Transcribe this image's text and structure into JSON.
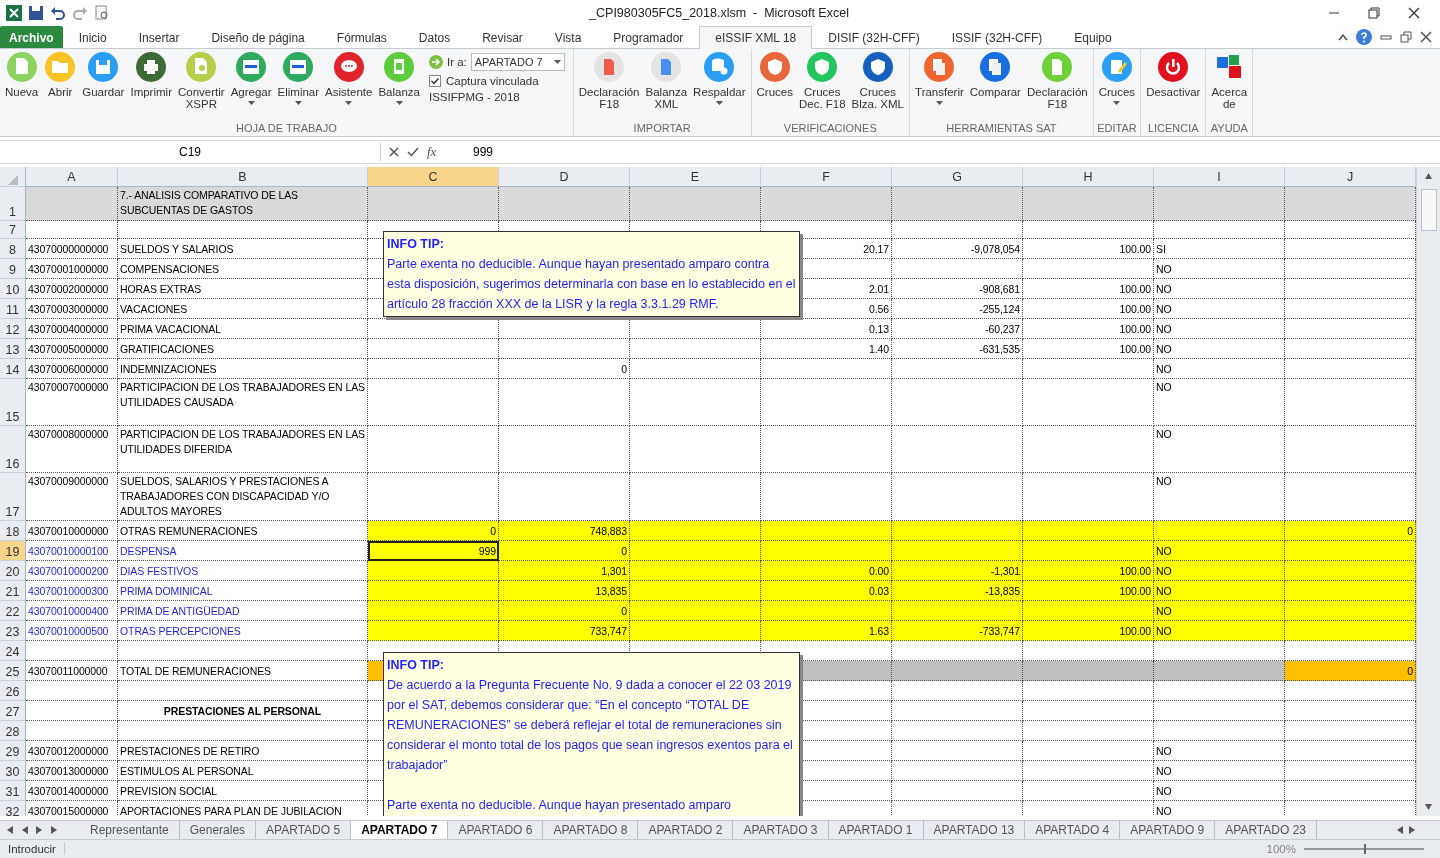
{
  "window": {
    "title": "_CPI980305FC5_2018.xlsm  -  Microsoft Excel"
  },
  "tabs": [
    {
      "label": "Archivo",
      "kind": "file",
      "selected": false
    },
    {
      "label": "Inicio",
      "kind": "tab",
      "selected": false
    },
    {
      "label": "Insertar",
      "kind": "tab",
      "selected": false
    },
    {
      "label": "Diseño de página",
      "kind": "tab",
      "selected": false
    },
    {
      "label": "Fórmulas",
      "kind": "tab",
      "selected": false
    },
    {
      "label": "Datos",
      "kind": "tab",
      "selected": false
    },
    {
      "label": "Revisar",
      "kind": "tab",
      "selected": false
    },
    {
      "label": "Vista",
      "kind": "tab",
      "selected": false
    },
    {
      "label": "Programador",
      "kind": "tab",
      "selected": false
    },
    {
      "label": "eISSIF XML 18",
      "kind": "tab",
      "selected": true
    },
    {
      "label": "DISIF (32H-CFF)",
      "kind": "tab",
      "selected": false
    },
    {
      "label": "ISSIF (32H-CFF)",
      "kind": "tab",
      "selected": false
    },
    {
      "label": "Equipo",
      "kind": "tab",
      "selected": false
    }
  ],
  "ribbon": {
    "groups": [
      {
        "label": "HOJA DE TRABAJO",
        "buttons": [
          {
            "label": "Nueva",
            "dropdown": false
          },
          {
            "label": "Abrir",
            "dropdown": false
          },
          {
            "label": "Guardar",
            "dropdown": false
          },
          {
            "label": "Imprimir",
            "dropdown": false
          },
          {
            "label": "Convertir\nXSPR",
            "dropdown": false
          },
          {
            "label": "Agregar",
            "dropdown": true
          },
          {
            "label": "Eliminar",
            "dropdown": true
          },
          {
            "label": "Asistente",
            "dropdown": true
          },
          {
            "label": "Balanza",
            "dropdown": true
          }
        ],
        "goto": {
          "label": "Ir a:",
          "value": "APARTADO 7"
        },
        "checkbox": {
          "label": "Captura vinculada",
          "checked": true
        },
        "note": "ISSIFPMG - 2018"
      },
      {
        "label": "IMPORTAR",
        "buttons": [
          {
            "label": "Declaración\nF18",
            "dropdown": false
          },
          {
            "label": "Balanza\nXML",
            "dropdown": false
          },
          {
            "label": "Respaldar",
            "dropdown": true
          }
        ]
      },
      {
        "label": "VERIFICACIONES",
        "buttons": [
          {
            "label": "Cruces",
            "dropdown": false
          },
          {
            "label": "Cruces\nDec. F18",
            "dropdown": false
          },
          {
            "label": "Cruces\nBlza. XML",
            "dropdown": false
          }
        ]
      },
      {
        "label": "HERRAMIENTAS SAT",
        "buttons": [
          {
            "label": "Transferir",
            "dropdown": true
          },
          {
            "label": "Comparar",
            "dropdown": false
          },
          {
            "label": "Declaración\nF18",
            "dropdown": false
          }
        ]
      },
      {
        "label": "EDITAR",
        "buttons": [
          {
            "label": "Cruces",
            "dropdown": true
          }
        ]
      },
      {
        "label": "LICENCIA",
        "buttons": [
          {
            "label": "Desactivar",
            "dropdown": false
          }
        ]
      },
      {
        "label": "AYUDA",
        "buttons": [
          {
            "label": "Acerca\nde",
            "dropdown": false
          }
        ]
      }
    ]
  },
  "formula_bar": {
    "name_box": "C19",
    "function_label": "fx",
    "value": "999"
  },
  "columns": [
    {
      "label": "A",
      "selected": false
    },
    {
      "label": "B",
      "selected": false
    },
    {
      "label": "C",
      "selected": true
    },
    {
      "label": "D",
      "selected": false
    },
    {
      "label": "E",
      "selected": false
    },
    {
      "label": "F",
      "selected": false
    },
    {
      "label": "G",
      "selected": false
    },
    {
      "label": "H",
      "selected": false
    },
    {
      "label": "I",
      "selected": false
    },
    {
      "label": "J",
      "selected": false
    }
  ],
  "rows": [
    {
      "n": "1",
      "kind": "header",
      "highlighted": false,
      "link": false,
      "selected": false,
      "cells": [
        "",
        "7.- ANALISIS COMPARATIVO DE LAS\nSUBCUENTAS DE GASTOS",
        "",
        "",
        "",
        "",
        "",
        "",
        "",
        ""
      ]
    },
    {
      "n": "7",
      "kind": "plain",
      "highlighted": false,
      "link": false,
      "selected": false,
      "cells": [
        "",
        "",
        "",
        "",
        "",
        "",
        "",
        "",
        "",
        ""
      ]
    },
    {
      "n": "8",
      "kind": "plain",
      "highlighted": false,
      "link": false,
      "selected": false,
      "cells": [
        "43070000000000",
        "SUELDOS Y SALARIOS",
        "",
        "",
        "",
        "20.17",
        "-9,078,054",
        "100.00",
        "SI",
        ""
      ]
    },
    {
      "n": "9",
      "kind": "plain",
      "highlighted": false,
      "link": false,
      "selected": false,
      "cells": [
        "43070001000000",
        "COMPENSACIONES",
        "",
        "",
        "",
        "",
        "",
        "",
        "NO",
        ""
      ]
    },
    {
      "n": "10",
      "kind": "plain",
      "highlighted": false,
      "link": false,
      "selected": false,
      "cells": [
        "43070002000000",
        "HORAS EXTRAS",
        "",
        "",
        "",
        "2.01",
        "-908,681",
        "100.00",
        "NO",
        ""
      ]
    },
    {
      "n": "11",
      "kind": "plain",
      "highlighted": false,
      "link": false,
      "selected": false,
      "cells": [
        "43070003000000",
        "VACACIONES",
        "",
        "",
        "",
        "0.56",
        "-255,124",
        "100.00",
        "NO",
        ""
      ]
    },
    {
      "n": "12",
      "kind": "plain",
      "highlighted": false,
      "link": false,
      "selected": false,
      "cells": [
        "43070004000000",
        "PRIMA VACACIONAL",
        "",
        "",
        "",
        "0.13",
        "-60,237",
        "100.00",
        "NO",
        ""
      ]
    },
    {
      "n": "13",
      "kind": "plain",
      "highlighted": false,
      "link": false,
      "selected": false,
      "cells": [
        "43070005000000",
        "GRATIFICACIONES",
        "",
        "",
        "",
        "1.40",
        "-631,535",
        "100.00",
        "NO",
        ""
      ]
    },
    {
      "n": "14",
      "kind": "plain",
      "highlighted": false,
      "link": false,
      "selected": false,
      "cells": [
        "43070006000000",
        "INDEMNIZACIONES",
        "",
        "0",
        "",
        "",
        "",
        "",
        "NO",
        ""
      ]
    },
    {
      "n": "15",
      "kind": "tall",
      "highlighted": false,
      "link": false,
      "selected": false,
      "cells": [
        "43070007000000",
        "PARTICIPACION DE LOS TRABAJADORES EN LAS\nUTILIDADES CAUSADA",
        "",
        "",
        "",
        "",
        "",
        "",
        "NO",
        ""
      ]
    },
    {
      "n": "16",
      "kind": "tall",
      "highlighted": false,
      "link": false,
      "selected": false,
      "cells": [
        "43070008000000",
        "PARTICIPACION DE LOS TRABAJADORES EN LAS\nUTILIDADES DIFERIDA",
        "",
        "",
        "",
        "",
        "",
        "",
        "NO",
        ""
      ]
    },
    {
      "n": "17",
      "kind": "tall",
      "highlighted": false,
      "link": false,
      "selected": false,
      "cells": [
        "43070009000000",
        "SUELDOS, SALARIOS Y PRESTACIONES A\nTRABAJADORES CON DISCAPACIDAD Y/O\nADULTOS MAYORES",
        "",
        "",
        "",
        "",
        "",
        "",
        "NO",
        ""
      ]
    },
    {
      "n": "18",
      "kind": "plain",
      "highlighted": true,
      "link": false,
      "selected": false,
      "cells": [
        "43070010000000",
        "OTRAS REMUNERACIONES",
        "0",
        "748,883",
        "",
        "",
        "",
        "",
        "",
        "0"
      ]
    },
    {
      "n": "19",
      "kind": "plain",
      "highlighted": true,
      "link": true,
      "selected": true,
      "cells": [
        "43070010000100",
        "DESPENSA",
        "999",
        "0",
        "",
        "",
        "",
        "",
        "NO",
        ""
      ]
    },
    {
      "n": "20",
      "kind": "plain",
      "highlighted": true,
      "link": true,
      "selected": false,
      "cells": [
        "43070010000200",
        "DIAS FESTIVOS",
        "",
        "1,301",
        "",
        "0.00",
        "-1,301",
        "100.00",
        "NO",
        ""
      ]
    },
    {
      "n": "21",
      "kind": "plain",
      "highlighted": true,
      "link": true,
      "selected": false,
      "cells": [
        "43070010000300",
        "PRIMA DOMINICAL",
        "",
        "13,835",
        "",
        "0.03",
        "-13,835",
        "100.00",
        "NO",
        ""
      ]
    },
    {
      "n": "22",
      "kind": "plain",
      "highlighted": true,
      "link": true,
      "selected": false,
      "cells": [
        "43070010000400",
        "PRIMA DE ANTIGÜEDAD",
        "",
        "0",
        "",
        "",
        "",
        "",
        "NO",
        ""
      ]
    },
    {
      "n": "23",
      "kind": "plain",
      "highlighted": true,
      "link": true,
      "selected": false,
      "cells": [
        "43070010000500",
        "OTRAS PERCEPCIONES",
        "",
        "733,747",
        "",
        "1.63",
        "-733,747",
        "100.00",
        "NO",
        ""
      ]
    },
    {
      "n": "24",
      "kind": "plain",
      "highlighted": false,
      "link": false,
      "selected": false,
      "cells": [
        "",
        "",
        "",
        "",
        "",
        "",
        "",
        "",
        "",
        ""
      ]
    },
    {
      "n": "25",
      "kind": "total",
      "highlighted": false,
      "link": false,
      "selected": false,
      "cells": [
        "43070011000000",
        "TOTAL DE REMUNERACIONES",
        "",
        "",
        "",
        "",
        "",
        "",
        "",
        "0"
      ]
    },
    {
      "n": "26",
      "kind": "plain",
      "highlighted": false,
      "link": false,
      "selected": false,
      "cells": [
        "",
        "",
        "",
        "",
        "",
        "",
        "",
        "",
        "",
        ""
      ]
    },
    {
      "n": "27",
      "kind": "section",
      "highlighted": false,
      "link": false,
      "selected": false,
      "cells": [
        "",
        "PRESTACIONES AL PERSONAL",
        "",
        "",
        "",
        "",
        "",
        "",
        "",
        ""
      ]
    },
    {
      "n": "28",
      "kind": "plain",
      "highlighted": false,
      "link": false,
      "selected": false,
      "cells": [
        "",
        "",
        "",
        "",
        "",
        "",
        "",
        "",
        "",
        ""
      ]
    },
    {
      "n": "29",
      "kind": "plain",
      "highlighted": false,
      "link": false,
      "selected": false,
      "cells": [
        "43070012000000",
        "PRESTACIONES DE RETIRO",
        "",
        "",
        "",
        "",
        "",
        "",
        "NO",
        ""
      ]
    },
    {
      "n": "30",
      "kind": "plain",
      "highlighted": false,
      "link": false,
      "selected": false,
      "cells": [
        "43070013000000",
        "ESTIMULOS AL PERSONAL",
        "",
        "",
        "",
        "",
        "",
        "",
        "NO",
        ""
      ]
    },
    {
      "n": "31",
      "kind": "plain",
      "highlighted": false,
      "link": false,
      "selected": false,
      "cells": [
        "43070014000000",
        "PREVISION SOCIAL",
        "",
        "",
        "",
        "",
        "",
        "",
        "NO",
        ""
      ]
    },
    {
      "n": "32",
      "kind": "plain",
      "highlighted": false,
      "link": false,
      "selected": false,
      "cells": [
        "43070015000000",
        "APORTACIONES PARA PLAN DE JUBILACION",
        "",
        "",
        "",
        "",
        "",
        "",
        "NO",
        ""
      ]
    }
  ],
  "comments": [
    {
      "title": "INFO TIP:",
      "paragraphs": [
        "Parte exenta no deducible. Aunque hayan presentado amparo contra esta disposición, sugerimos determinarla con base en lo establecido en el artículo 28 fracción XXX de la LISR y la regla 3.3.1.29 RMF."
      ]
    },
    {
      "title": "INFO TIP:",
      "paragraphs": [
        "De acuerdo a la Pregunta Frecuente No. 9 dada a conocer el 22 03 2019 por el SAT, debemos considerar que: “En el concepto “TOTAL DE REMUNERACIONES” se deberá reflejar el total de remuneraciones sin considerar el monto total de los pagos que sean ingresos exentos para el trabajador”",
        "Parte exenta no deducible. Aunque hayan presentado amparo"
      ]
    }
  ],
  "sheet_tabs": [
    {
      "label": "Representante",
      "selected": false
    },
    {
      "label": "Generales",
      "selected": false
    },
    {
      "label": "APARTADO 5",
      "selected": false
    },
    {
      "label": "APARTADO 7",
      "selected": true
    },
    {
      "label": "APARTADO 6",
      "selected": false
    },
    {
      "label": "APARTADO 8",
      "selected": false
    },
    {
      "label": "APARTADO 2",
      "selected": false
    },
    {
      "label": "APARTADO 3",
      "selected": false
    },
    {
      "label": "APARTADO 1",
      "selected": false
    },
    {
      "label": "APARTADO 13",
      "selected": false
    },
    {
      "label": "APARTADO 4",
      "selected": false
    },
    {
      "label": "APARTADO 9",
      "selected": false
    },
    {
      "label": "APARTADO 23",
      "selected": false
    }
  ],
  "status_bar": {
    "mode": "Introducir",
    "zoom": "100%",
    "zoom_slider": {
      "level": 0.5
    }
  }
}
